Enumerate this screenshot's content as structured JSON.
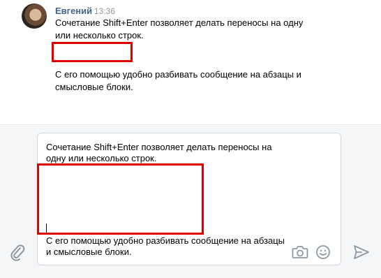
{
  "message": {
    "author": "Евгений",
    "time": "13:36",
    "lines": [
      "Сочетание Shift+Enter позволяет делать переносы на одну",
      "или несколько строк.",
      "С его помощью удобно разбивать сообщение на абзацы и",
      "смысловые блоки."
    ]
  },
  "composer": {
    "lines": [
      "Сочетание Shift+Enter позволяет делать переносы на",
      "одну или несколько строк.",
      "С его помощью удобно разбивать сообщение на абзацы",
      "и смысловые блоки."
    ]
  },
  "icons": {
    "attach": "paperclip-icon",
    "camera": "camera-icon",
    "emoji": "smile-icon",
    "send": "send-icon"
  },
  "colors": {
    "author_name": "#42648b",
    "highlight_box": "#e00000",
    "icon": "#8c99a5"
  }
}
